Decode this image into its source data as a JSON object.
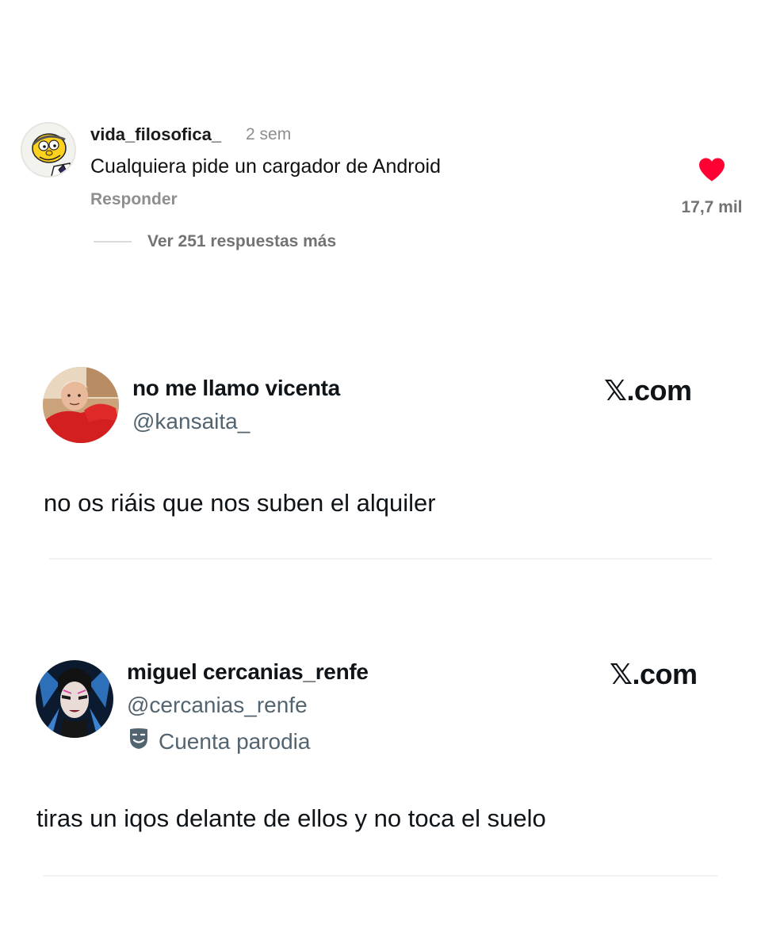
{
  "instagram_comment": {
    "username": "vida_filosofica_",
    "time_ago": "2 sem",
    "text": "Cualquiera pide un cargador de Android",
    "reply_label": "Responder",
    "like_count": "17,7 mil",
    "more_replies_label": "Ver 251 respuestas más",
    "heart_color": "#ff0033"
  },
  "tweets": [
    {
      "display_name": "no me llamo vicenta",
      "handle": "@kansaita_",
      "brand": "𝕏.com",
      "text": "no os riáis que nos suben el alquiler"
    },
    {
      "display_name": "miguel cercanias_renfe",
      "handle": "@cercanias_renfe",
      "badge_label": "Cuenta parodia",
      "badge_icon": "theater-masks-icon",
      "brand": "𝕏.com",
      "text": "tiras un iqos delante de ellos y no toca el suelo"
    }
  ]
}
